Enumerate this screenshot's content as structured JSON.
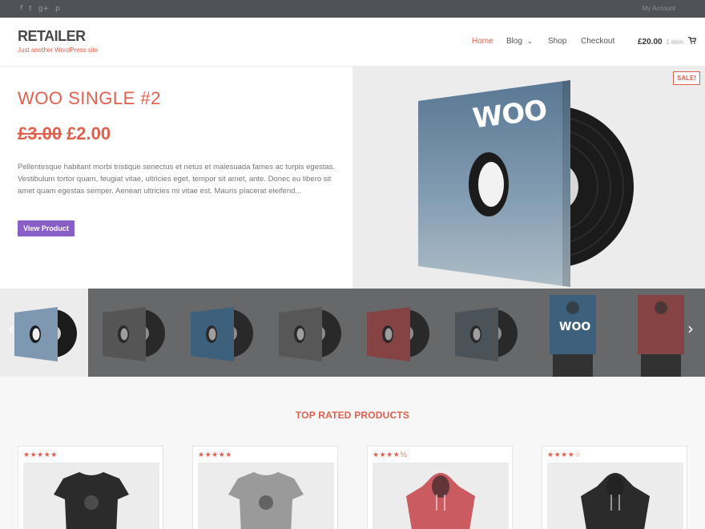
{
  "topbar": {
    "social_icons": [
      "facebook-icon",
      "twitter-icon",
      "google-plus-icon",
      "pinterest-icon"
    ],
    "social_glyphs": [
      "f",
      "t",
      "g+",
      "p"
    ],
    "my_account": "My Account"
  },
  "header": {
    "logo": "RETAILER",
    "tagline": "Just another WordPress site"
  },
  "nav": {
    "home": "Home",
    "blog": "Blog",
    "shop": "Shop",
    "checkout": "Checkout"
  },
  "cart": {
    "amount": "£20.00",
    "count": "1 item"
  },
  "hero": {
    "title": "WOO SINGLE #2",
    "old_price": "£3.00",
    "new_price": "£2.00",
    "description": "Pellentesque habitant morbi tristique senectus et netus et malesuada fames ac turpis egestas. Vestibulum tortor quam, feugiat vitae, ultricies eget, tempor sit amet, ante. Donec eu libero sit amet quam egestas semper. Aenean ultricies mi vitae est. Mauris placerat eleifend...",
    "button": "View Product",
    "sale_badge": "SALE!",
    "album_text": "WOO"
  },
  "thumbnails": [
    {
      "kind": "album",
      "sleeve": "#7d98b0",
      "active": true
    },
    {
      "kind": "album",
      "sleeve": "#6a6a6a",
      "active": false
    },
    {
      "kind": "album",
      "sleeve": "#3f7fb3",
      "active": false
    },
    {
      "kind": "album",
      "sleeve": "#6d6d6d",
      "active": false
    },
    {
      "kind": "album",
      "sleeve": "#c24a4a",
      "active": false
    },
    {
      "kind": "album",
      "sleeve": "#5a6670",
      "active": false
    },
    {
      "kind": "poster",
      "sleeve": "#3f7fb3",
      "label": "WOO",
      "active": false
    },
    {
      "kind": "poster",
      "sleeve": "#c24a4a",
      "label": "",
      "active": false
    }
  ],
  "section": {
    "title": "TOP RATED PRODUCTS"
  },
  "products": [
    {
      "stars": "★★★★★",
      "rating": 5,
      "garment": "tshirt",
      "color": "#2b2b2b"
    },
    {
      "stars": "★★★★★",
      "rating": 5,
      "garment": "tshirt",
      "color": "#9a9a9a"
    },
    {
      "stars": "★★★★½",
      "rating": 4.5,
      "garment": "hoodie",
      "color": "#c95b61"
    },
    {
      "stars": "★★★★☆",
      "rating": 4,
      "garment": "hoodie",
      "color": "#2b2b2b"
    }
  ],
  "colors": {
    "accent": "#e0604e",
    "button": "#8a5ec7",
    "topbar": "#4f5256"
  }
}
